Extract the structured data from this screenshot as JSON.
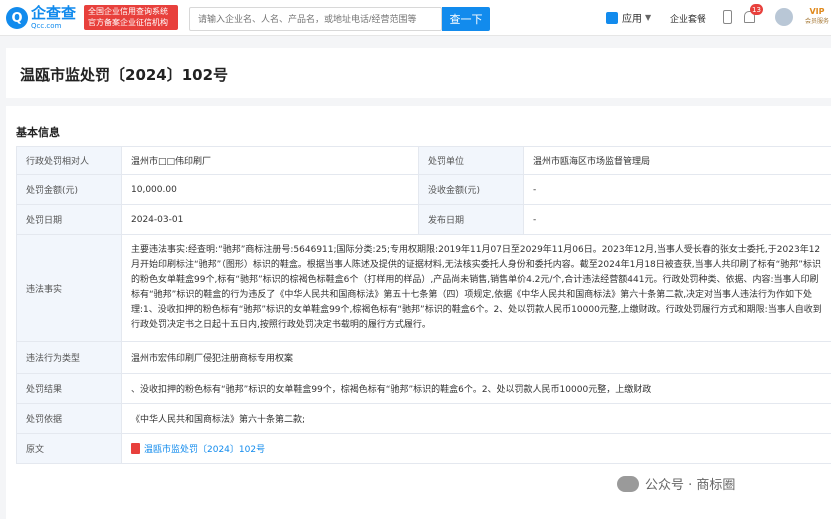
{
  "header": {
    "logo_mark": "Q",
    "logo_name": "企查查",
    "logo_sub": "Qcc.com",
    "badge_line1": "全国企业信用查询系统",
    "badge_line2": "官方备案企业征信机构",
    "search_placeholder": "请输入企业名、人名、产品名，或地址电话/经营范围等",
    "search_button": "查一下",
    "apps_label": "应用",
    "package_label": "企业套餐",
    "notification_count": "13",
    "vip_label": "VIP",
    "vip_sub": "会员服务",
    "brand_color": "#128bed"
  },
  "title": "温瓯市监处罚〔2024〕102号",
  "section_title": "基本信息",
  "rows": {
    "party_label": "行政处罚相对人",
    "party_value": "温州市□□伟印刷厂",
    "dept_label": "处罚单位",
    "dept_value": "温州市瓯海区市场监督管理局",
    "amount_label": "处罚金额(元)",
    "amount_value": "10,000.00",
    "confiscated_label": "没收金额(元)",
    "confiscated_value": "-",
    "date_label": "处罚日期",
    "date_value": "2024-03-01",
    "publish_label": "发布日期",
    "publish_value": "-",
    "facts_label": "违法事实",
    "facts_value": "主要违法事实:经查明:“驰邦”商标注册号:5646911;国际分类:25;专用权期限:2019年11月07日至2029年11月06日。2023年12月,当事人受长春的张女士委托,于2023年12月开始印刷标注“驰邦”（图形）标识的鞋盒。根据当事人陈述及提供的证据材料,无法核实委托人身份和委托内容。截至2024年1月18日被查获,当事人共印刷了标有“驰邦”标识的粉色女单鞋盒99个,标有“驰邦”标识的棕褐色标鞋盒6个（打样用的样品）,产品尚未销售,销售单价4.2元/个,合计违法经营额441元。行政处罚种类、依据、内容:当事人印刷标有“驰邦”标识的鞋盒的行为违反了《中华人民共和国商标法》第五十七条第（四）项规定,依据《中华人民共和国商标法》第六十条第二款,决定对当事人违法行为作如下处理:1、没收扣押的粉色标有“驰邦”标识的女单鞋盒99个,棕褐色标有“驰邦”标识的鞋盒6个。2、处以罚款人民币10000元整,上缴财政。行政处罚履行方式和期限:当事人自收到行政处罚决定书之日起十五日内,按照行政处罚决定书载明的履行方式履行。",
    "type_label": "违法行为类型",
    "type_value": "温州市宏伟印刷厂侵犯注册商标专用权案",
    "result_label": "处罚结果",
    "result_value": "、没收扣押的粉色标有“驰邦”标识的女单鞋盒99个，棕褐色标有“驰邦”标识的鞋盒6个。2、处以罚款人民币10000元整，上缴财政",
    "basis_label": "处罚依据",
    "basis_value": "《中华人民共和国商标法》第六十条第二款;",
    "original_label": "原文",
    "original_value": "温瓯市监处罚〔2024〕102号"
  },
  "watermark": "公众号 · 商标圈"
}
